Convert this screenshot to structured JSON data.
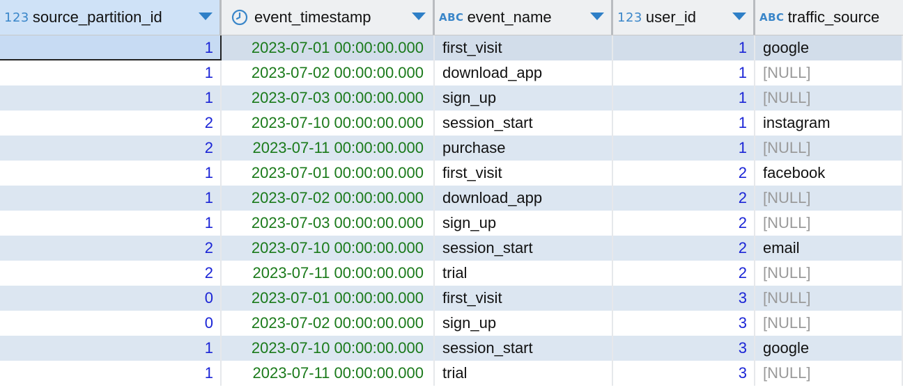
{
  "columns": [
    {
      "name": "source_partition_id",
      "type_icon": "123",
      "icon_name": "numeric-type-icon"
    },
    {
      "name": "event_timestamp",
      "type_icon": "clock",
      "icon_name": "clock-icon"
    },
    {
      "name": "event_name",
      "type_icon": "ABC",
      "icon_name": "text-type-icon"
    },
    {
      "name": "user_id",
      "type_icon": "123",
      "icon_name": "numeric-type-icon"
    },
    {
      "name": "traffic_source",
      "type_icon": "ABC",
      "icon_name": "text-type-icon"
    }
  ],
  "rows": [
    {
      "source_partition_id": "1",
      "event_timestamp": "2023-07-01 00:00:00.000",
      "event_name": "first_visit",
      "user_id": "1",
      "traffic_source": "google"
    },
    {
      "source_partition_id": "1",
      "event_timestamp": "2023-07-02 00:00:00.000",
      "event_name": "download_app",
      "user_id": "1",
      "traffic_source": "[NULL]"
    },
    {
      "source_partition_id": "1",
      "event_timestamp": "2023-07-03 00:00:00.000",
      "event_name": "sign_up",
      "user_id": "1",
      "traffic_source": "[NULL]"
    },
    {
      "source_partition_id": "2",
      "event_timestamp": "2023-07-10 00:00:00.000",
      "event_name": "session_start",
      "user_id": "1",
      "traffic_source": "instagram"
    },
    {
      "source_partition_id": "2",
      "event_timestamp": "2023-07-11 00:00:00.000",
      "event_name": "purchase",
      "user_id": "1",
      "traffic_source": "[NULL]"
    },
    {
      "source_partition_id": "1",
      "event_timestamp": "2023-07-01 00:00:00.000",
      "event_name": "first_visit",
      "user_id": "2",
      "traffic_source": "facebook"
    },
    {
      "source_partition_id": "1",
      "event_timestamp": "2023-07-02 00:00:00.000",
      "event_name": "download_app",
      "user_id": "2",
      "traffic_source": "[NULL]"
    },
    {
      "source_partition_id": "1",
      "event_timestamp": "2023-07-03 00:00:00.000",
      "event_name": "sign_up",
      "user_id": "2",
      "traffic_source": "[NULL]"
    },
    {
      "source_partition_id": "2",
      "event_timestamp": "2023-07-10 00:00:00.000",
      "event_name": "session_start",
      "user_id": "2",
      "traffic_source": "email"
    },
    {
      "source_partition_id": "2",
      "event_timestamp": "2023-07-11 00:00:00.000",
      "event_name": "trial",
      "user_id": "2",
      "traffic_source": "[NULL]"
    },
    {
      "source_partition_id": "0",
      "event_timestamp": "2023-07-01 00:00:00.000",
      "event_name": "first_visit",
      "user_id": "3",
      "traffic_source": "[NULL]"
    },
    {
      "source_partition_id": "0",
      "event_timestamp": "2023-07-02 00:00:00.000",
      "event_name": "sign_up",
      "user_id": "3",
      "traffic_source": "[NULL]"
    },
    {
      "source_partition_id": "1",
      "event_timestamp": "2023-07-10 00:00:00.000",
      "event_name": "session_start",
      "user_id": "3",
      "traffic_source": "google"
    },
    {
      "source_partition_id": "1",
      "event_timestamp": "2023-07-11 00:00:00.000",
      "event_name": "trial",
      "user_id": "3",
      "traffic_source": "[NULL]"
    }
  ],
  "colors": {
    "number_text": "#1a24d6",
    "timestamp_text": "#1a7a1a",
    "null_text": "#9a9a9a",
    "alt_row": "#dce6f1",
    "type_icon": "#3a86c9"
  }
}
